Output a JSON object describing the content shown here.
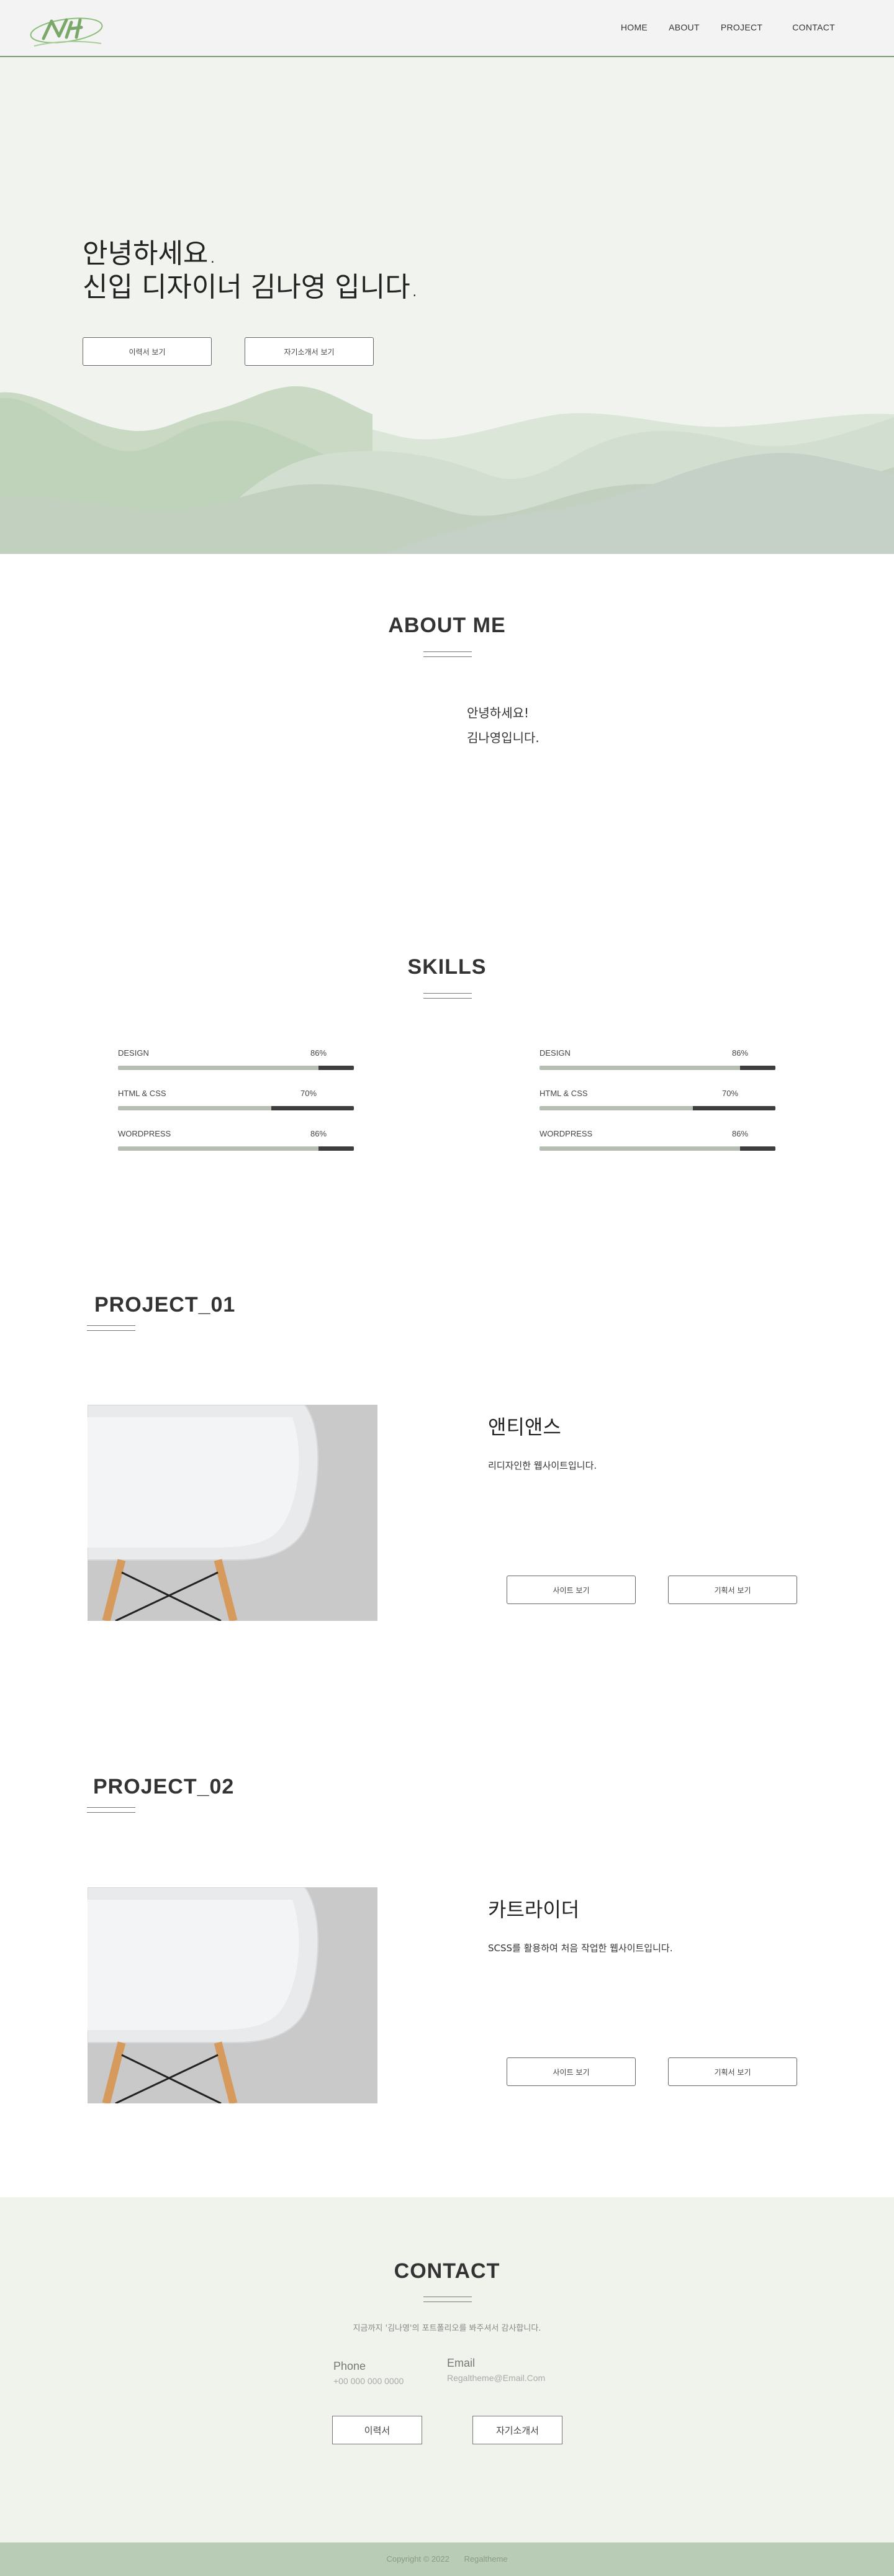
{
  "nav": {
    "items": [
      "HOME",
      "ABOUT",
      "PROJECT",
      "CONTACT"
    ]
  },
  "hero": {
    "line1": "안녕하세요.",
    "line2": "신입 디자이너 김나영 입니다.",
    "btn_resume": "이력서 보기",
    "btn_intro": "자기소개서 보기"
  },
  "about": {
    "title": "ABOUT ME",
    "line1": "안녕하세요!",
    "line2": "김나영입니다."
  },
  "skills": {
    "title": "SKILLS",
    "left": [
      {
        "name": "DESIGN",
        "pct": "86%",
        "value": 86
      },
      {
        "name": "HTML & CSS",
        "pct": "70%",
        "value": 70
      },
      {
        "name": "WORDPRESS",
        "pct": "86%",
        "value": 86
      }
    ],
    "right": [
      {
        "name": "DESIGN",
        "pct": "86%",
        "value": 86
      },
      {
        "name": "HTML & CSS",
        "pct": "70%",
        "value": 70
      },
      {
        "name": "WORDPRESS",
        "pct": "86%",
        "value": 86
      }
    ]
  },
  "projects": [
    {
      "title": "PROJECT_01",
      "name": "앤티앤스",
      "desc": "리디자인한 웹사이트입니다.",
      "btn_site": "사이트 보기",
      "btn_plan": "기획서 보기"
    },
    {
      "title": "PROJECT_02",
      "name": "카트라이더",
      "desc": "SCSS를 활용하여 처음 작업한 웹사이트입니다.",
      "btn_site": "사이트 보기",
      "btn_plan": "기획서 보기"
    }
  ],
  "contact": {
    "title": "CONTACT",
    "subtitle": "지금까지 '김나영'의 포트폴리오를 봐주셔서 감사합니다.",
    "phone_label": "Phone",
    "phone_value": "+00 000 000 0000",
    "email_label": "Email",
    "email_value": "Regaltheme@Email.Com",
    "btn_resume": "이력서",
    "btn_intro": "자기소개서"
  },
  "footer": {
    "copyright": "Copyright © 2022",
    "brand": "Regaltheme"
  },
  "colors": {
    "accent": "#7d9a78",
    "hero_bg": "#f1f3ef",
    "footer_bg": "#b9ccb6"
  }
}
